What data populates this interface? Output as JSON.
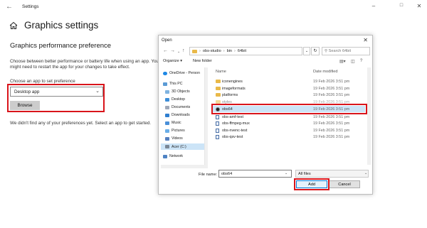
{
  "window": {
    "title": "Settings"
  },
  "settings": {
    "page_title": "Graphics settings",
    "section_title": "Graphics performance preference",
    "description": "Choose between better performance or battery life when using an app. You might need to restart the app for your changes to take effect.",
    "choose_label": "Choose an app to set preference",
    "app_type_value": "Desktop app",
    "browse_label": "Browse",
    "empty_message": "We didn't find any of your preferences yet. Select an app to get started."
  },
  "dialog": {
    "title": "Open",
    "breadcrumb": [
      "obs-studio",
      "bin",
      "64bit"
    ],
    "search_placeholder": "Search 64bit",
    "organize_label": "Organize",
    "new_folder_label": "New folder",
    "sidebar": [
      {
        "label": "OneDrive - Person",
        "icon": "cloud-icon"
      },
      {
        "label": "This PC",
        "icon": "computer-icon"
      },
      {
        "label": "3D Objects",
        "icon": "cube-icon"
      },
      {
        "label": "Desktop",
        "icon": "desktop-icon"
      },
      {
        "label": "Documents",
        "icon": "documents-icon"
      },
      {
        "label": "Downloads",
        "icon": "download-icon"
      },
      {
        "label": "Music",
        "icon": "music-icon"
      },
      {
        "label": "Pictures",
        "icon": "pictures-icon"
      },
      {
        "label": "Videos",
        "icon": "videos-icon"
      },
      {
        "label": "Acer (C:)",
        "icon": "drive-icon"
      },
      {
        "label": "Network",
        "icon": "network-icon"
      }
    ],
    "columns": {
      "name": "Name",
      "date": "Date modified"
    },
    "files": [
      {
        "name": "iconengines",
        "date": "19 Feb 2026 3:51 pm",
        "type": "folder"
      },
      {
        "name": "imageformats",
        "date": "19 Feb 2026 3:51 pm",
        "type": "folder"
      },
      {
        "name": "platforms",
        "date": "19 Feb 2026 3:51 pm",
        "type": "folder"
      },
      {
        "name": "styles",
        "date": "19 Feb 2026 3:51 pm",
        "type": "folder"
      },
      {
        "name": "obs64",
        "date": "19 Feb 2026 3:51 pm",
        "type": "app"
      },
      {
        "name": "obs-amf-test",
        "date": "19 Feb 2026 3:51 pm",
        "type": "exe"
      },
      {
        "name": "obs-ffmpeg-mux",
        "date": "19 Feb 2026 3:51 pm",
        "type": "exe"
      },
      {
        "name": "obs-nvenc-test",
        "date": "19 Feb 2026 3:51 pm",
        "type": "exe"
      },
      {
        "name": "obs-qsv-test",
        "date": "19 Feb 2026 3:51 pm",
        "type": "exe"
      }
    ],
    "file_name_label": "File name:",
    "file_name_value": "obs64",
    "file_type_value": "All files",
    "add_label": "Add",
    "cancel_label": "Cancel"
  },
  "colors": {
    "highlight": "#d9141b",
    "selection": "#cce4f7",
    "accent": "#0078d7"
  }
}
